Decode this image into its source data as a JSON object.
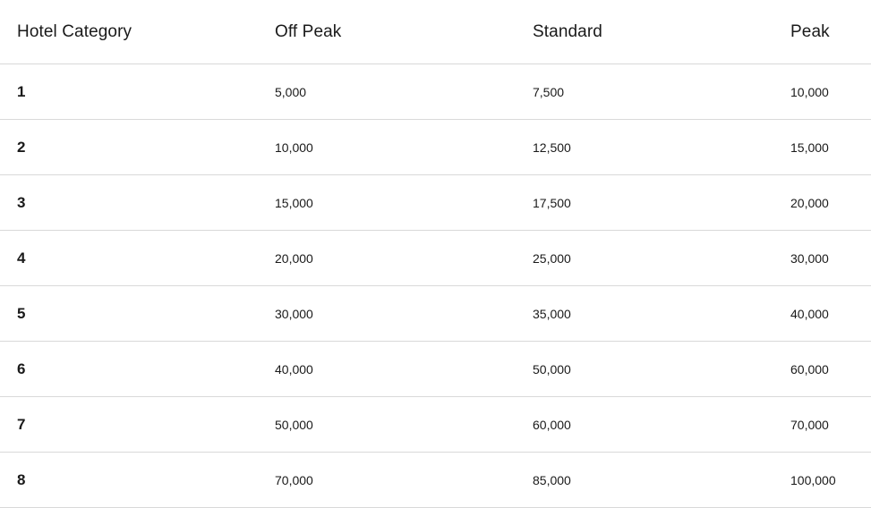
{
  "table": {
    "headers": [
      "Hotel Category",
      "Off Peak",
      "Standard",
      "Peak"
    ],
    "rows": [
      [
        "1",
        "5,000",
        "7,500",
        "10,000"
      ],
      [
        "2",
        "10,000",
        "12,500",
        "15,000"
      ],
      [
        "3",
        "15,000",
        "17,500",
        "20,000"
      ],
      [
        "4",
        "20,000",
        "25,000",
        "30,000"
      ],
      [
        "5",
        "30,000",
        "35,000",
        "40,000"
      ],
      [
        "6",
        "40,000",
        "50,000",
        "60,000"
      ],
      [
        "7",
        "50,000",
        "60,000",
        "70,000"
      ],
      [
        "8",
        "70,000",
        "85,000",
        "100,000"
      ]
    ]
  },
  "colors": {
    "text": "#1a1a1a",
    "divider": "#d9d9d9",
    "background": "#ffffff"
  }
}
